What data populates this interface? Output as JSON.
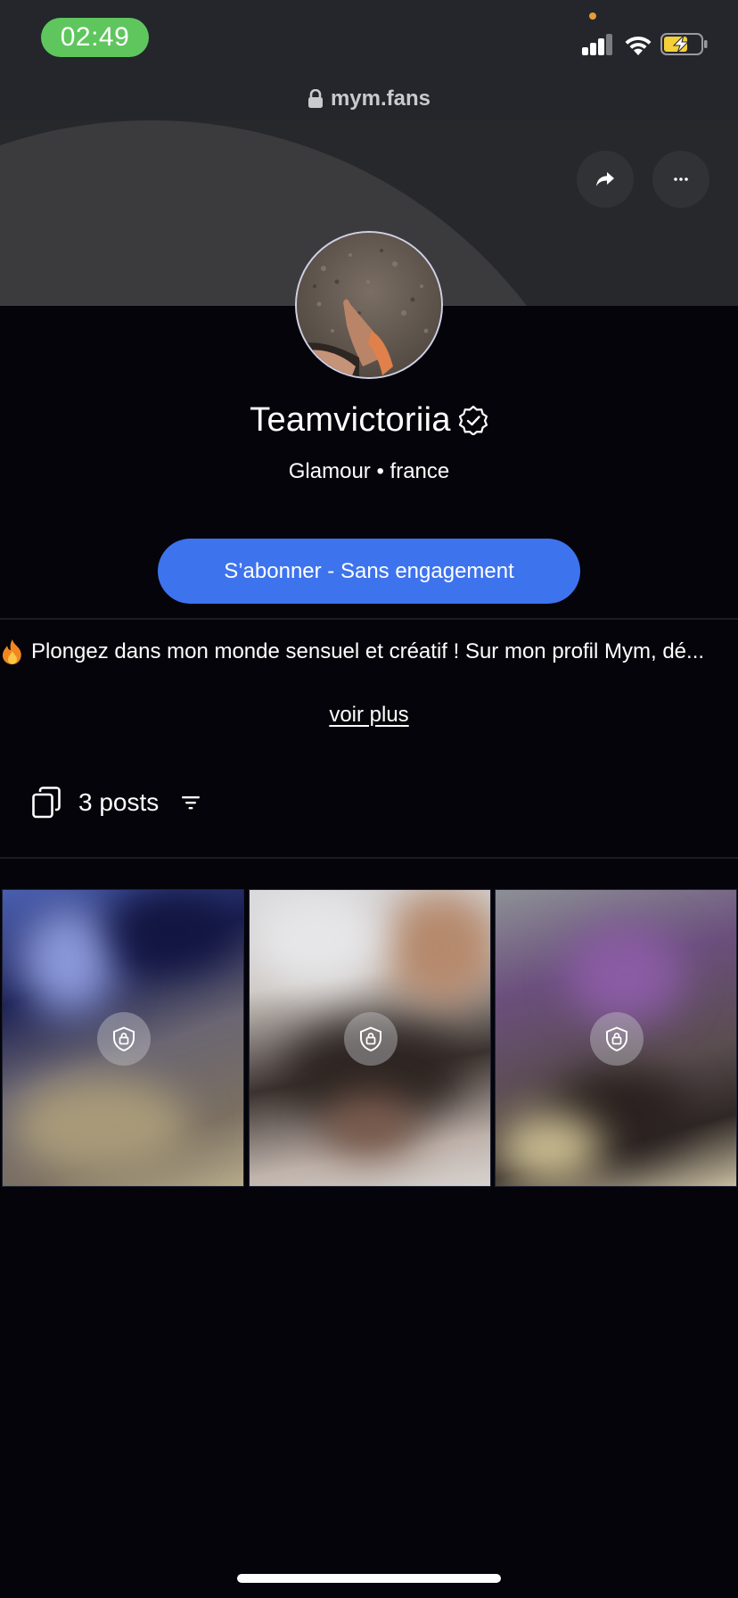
{
  "status_bar": {
    "time": "02:49",
    "signal_icon": "cellular-signal-icon",
    "wifi_icon": "wifi-icon",
    "battery_icon": "battery-charging-icon"
  },
  "browser": {
    "url": "mym.fans",
    "lock_icon": "lock-icon"
  },
  "header_actions": {
    "share_icon": "share-arrow-icon",
    "more_icon": "more-dots-icon"
  },
  "profile": {
    "name": "Teamvictoriia",
    "verified_icon": "verified-badge-icon",
    "category": "Glamour • france",
    "subscribe_label": "S’abonner - Sans engagement",
    "bio": "Plongez dans mon monde sensuel et créatif ! Sur mon profil Mym, dé...",
    "bio_icon": "fire-emoji-icon",
    "see_more_label": "voir plus"
  },
  "posts": {
    "count_label": "3 posts",
    "posts_icon": "copy-stack-icon",
    "filter_icon": "filter-icon",
    "items": [
      {
        "locked": true,
        "lock_icon": "locked-shield-icon"
      },
      {
        "locked": true,
        "lock_icon": "locked-shield-icon"
      },
      {
        "locked": true,
        "lock_icon": "locked-shield-icon"
      }
    ]
  },
  "colors": {
    "status_bar_bg": "#24262b",
    "page_bg": "#04040a",
    "time_pill": "#5fc65d",
    "subscribe_button": "#3e73ee",
    "battery_fill": "#f4cf3a"
  }
}
